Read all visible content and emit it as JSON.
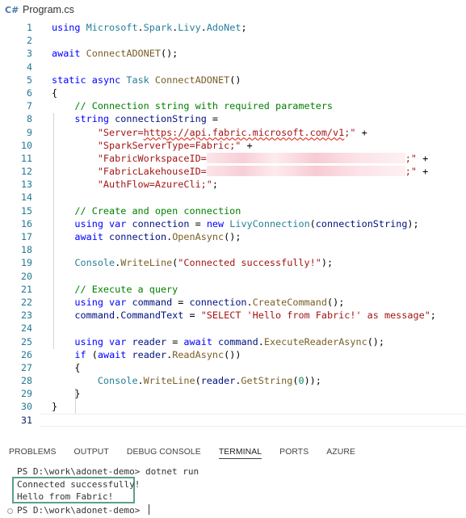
{
  "tab": {
    "icon": "csharp-file-icon",
    "label": "Program.cs"
  },
  "lines": [
    {
      "n": "1",
      "tokens": [
        [
          "kw",
          "using"
        ],
        [
          "pn",
          " "
        ],
        [
          "ty",
          "Microsoft"
        ],
        [
          "pn",
          "."
        ],
        [
          "ty",
          "Spark"
        ],
        [
          "pn",
          "."
        ],
        [
          "ty",
          "Livy"
        ],
        [
          "pn",
          "."
        ],
        [
          "ty",
          "AdoNet"
        ],
        [
          "pn",
          ";"
        ]
      ]
    },
    {
      "n": "2",
      "tokens": []
    },
    {
      "n": "3",
      "tokens": [
        [
          "kw",
          "await"
        ],
        [
          "pn",
          " "
        ],
        [
          "fn",
          "ConnectADONET"
        ],
        [
          "pn",
          "();"
        ]
      ]
    },
    {
      "n": "4",
      "tokens": []
    },
    {
      "n": "5",
      "tokens": [
        [
          "kw",
          "static"
        ],
        [
          "pn",
          " "
        ],
        [
          "kw",
          "async"
        ],
        [
          "pn",
          " "
        ],
        [
          "ty",
          "Task"
        ],
        [
          "pn",
          " "
        ],
        [
          "fn",
          "ConnectADONET"
        ],
        [
          "pn",
          "()"
        ]
      ]
    },
    {
      "n": "6",
      "tokens": [
        [
          "pn",
          "{"
        ]
      ]
    },
    {
      "n": "7",
      "tokens": [
        [
          "pn",
          "    "
        ],
        [
          "cm",
          "// Connection string with required parameters"
        ]
      ]
    },
    {
      "n": "8",
      "tokens": [
        [
          "pn",
          "    "
        ],
        [
          "kw",
          "string"
        ],
        [
          "pn",
          " "
        ],
        [
          "var",
          "connectionString"
        ],
        [
          "pn",
          " ="
        ]
      ]
    },
    {
      "n": "9",
      "tokens": [
        [
          "pn",
          "        "
        ],
        [
          "str",
          "\"Server="
        ],
        [
          "str squig",
          "https://api.fabric.microsoft.com/v1"
        ],
        [
          "str",
          ";\""
        ],
        [
          "pn",
          " +"
        ]
      ]
    },
    {
      "n": "10",
      "tokens": [
        [
          "pn",
          "        "
        ],
        [
          "str",
          "\"SparkServerType=Fabric;\""
        ],
        [
          "pn",
          " +"
        ]
      ]
    },
    {
      "n": "11",
      "tokens": [
        [
          "pn",
          "        "
        ],
        [
          "str",
          "\"FabricWorkspaceID="
        ],
        [
          "redact",
          ""
        ],
        [
          "str",
          ";\""
        ],
        [
          "pn",
          " +"
        ]
      ]
    },
    {
      "n": "12",
      "tokens": [
        [
          "pn",
          "        "
        ],
        [
          "str",
          "\"FabricLakehouseID="
        ],
        [
          "redact",
          ""
        ],
        [
          "str",
          ";\""
        ],
        [
          "pn",
          " +"
        ]
      ]
    },
    {
      "n": "13",
      "tokens": [
        [
          "pn",
          "        "
        ],
        [
          "str",
          "\"AuthFlow=AzureCli;\""
        ],
        [
          "pn",
          ";"
        ]
      ]
    },
    {
      "n": "14",
      "tokens": []
    },
    {
      "n": "15",
      "tokens": [
        [
          "pn",
          "    "
        ],
        [
          "cm",
          "// Create and open connection"
        ]
      ]
    },
    {
      "n": "16",
      "tokens": [
        [
          "pn",
          "    "
        ],
        [
          "kw",
          "using"
        ],
        [
          "pn",
          " "
        ],
        [
          "kw",
          "var"
        ],
        [
          "pn",
          " "
        ],
        [
          "var",
          "connection"
        ],
        [
          "pn",
          " = "
        ],
        [
          "kw",
          "new"
        ],
        [
          "pn",
          " "
        ],
        [
          "ty",
          "LivyConnection"
        ],
        [
          "pn",
          "("
        ],
        [
          "var",
          "connectionString"
        ],
        [
          "pn",
          ");"
        ]
      ]
    },
    {
      "n": "17",
      "tokens": [
        [
          "pn",
          "    "
        ],
        [
          "kw",
          "await"
        ],
        [
          "pn",
          " "
        ],
        [
          "var",
          "connection"
        ],
        [
          "pn",
          "."
        ],
        [
          "fn",
          "OpenAsync"
        ],
        [
          "pn",
          "();"
        ]
      ]
    },
    {
      "n": "18",
      "tokens": []
    },
    {
      "n": "19",
      "tokens": [
        [
          "pn",
          "    "
        ],
        [
          "ty",
          "Console"
        ],
        [
          "pn",
          "."
        ],
        [
          "fn",
          "WriteLine"
        ],
        [
          "pn",
          "("
        ],
        [
          "str",
          "\"Connected successfully!\""
        ],
        [
          "pn",
          ");"
        ]
      ]
    },
    {
      "n": "20",
      "tokens": []
    },
    {
      "n": "21",
      "tokens": [
        [
          "pn",
          "    "
        ],
        [
          "cm",
          "// Execute a query"
        ]
      ]
    },
    {
      "n": "22",
      "tokens": [
        [
          "pn",
          "    "
        ],
        [
          "kw",
          "using"
        ],
        [
          "pn",
          " "
        ],
        [
          "kw",
          "var"
        ],
        [
          "pn",
          " "
        ],
        [
          "var",
          "command"
        ],
        [
          "pn",
          " = "
        ],
        [
          "var",
          "connection"
        ],
        [
          "pn",
          "."
        ],
        [
          "fn",
          "CreateCommand"
        ],
        [
          "pn",
          "();"
        ]
      ]
    },
    {
      "n": "23",
      "tokens": [
        [
          "pn",
          "    "
        ],
        [
          "var",
          "command"
        ],
        [
          "pn",
          "."
        ],
        [
          "var",
          "CommandText"
        ],
        [
          "pn",
          " = "
        ],
        [
          "str",
          "\"SELECT 'Hello from Fabric!' as message\""
        ],
        [
          "pn",
          ";"
        ]
      ]
    },
    {
      "n": "24",
      "tokens": []
    },
    {
      "n": "25",
      "tokens": [
        [
          "pn",
          "    "
        ],
        [
          "kw",
          "using"
        ],
        [
          "pn",
          " "
        ],
        [
          "kw",
          "var"
        ],
        [
          "pn",
          " "
        ],
        [
          "var",
          "reader"
        ],
        [
          "pn",
          " = "
        ],
        [
          "kw",
          "await"
        ],
        [
          "pn",
          " "
        ],
        [
          "var",
          "command"
        ],
        [
          "pn",
          "."
        ],
        [
          "fn",
          "ExecuteReaderAsync"
        ],
        [
          "pn",
          "();"
        ]
      ]
    },
    {
      "n": "26",
      "tokens": [
        [
          "pn",
          "    "
        ],
        [
          "kw",
          "if"
        ],
        [
          "pn",
          " ("
        ],
        [
          "kw",
          "await"
        ],
        [
          "pn",
          " "
        ],
        [
          "var",
          "reader"
        ],
        [
          "pn",
          "."
        ],
        [
          "fn",
          "ReadAsync"
        ],
        [
          "pn",
          "())"
        ]
      ]
    },
    {
      "n": "27",
      "tokens": [
        [
          "pn",
          "    {"
        ]
      ]
    },
    {
      "n": "28",
      "tokens": [
        [
          "pn",
          "        "
        ],
        [
          "ty",
          "Console"
        ],
        [
          "pn",
          "."
        ],
        [
          "fn",
          "WriteLine"
        ],
        [
          "pn",
          "("
        ],
        [
          "var",
          "reader"
        ],
        [
          "pn",
          "."
        ],
        [
          "fn",
          "GetString"
        ],
        [
          "pn",
          "("
        ],
        [
          "num",
          "0"
        ],
        [
          "pn",
          "));"
        ]
      ]
    },
    {
      "n": "29",
      "tokens": [
        [
          "pn",
          "    }"
        ]
      ]
    },
    {
      "n": "30",
      "tokens": [
        [
          "pn",
          "}"
        ]
      ]
    },
    {
      "n": "31",
      "tokens": []
    }
  ],
  "current_line": "31",
  "panel": {
    "tabs": [
      "PROBLEMS",
      "OUTPUT",
      "DEBUG CONSOLE",
      "TERMINAL",
      "PORTS",
      "AZURE"
    ],
    "active_tab": "TERMINAL"
  },
  "terminal": {
    "prompt1": "PS D:\\work\\adonet-demo> dotnet run",
    "out1": "Connected successfully!",
    "out2": "Hello from Fabric!",
    "prompt2": "PS D:\\work\\adonet-demo> "
  },
  "colors": {
    "keyword": "#0000ff",
    "type": "#267f99",
    "function": "#795e26",
    "variable": "#001080",
    "string": "#a31515",
    "comment": "#008000",
    "line_number": "#237893",
    "highlight_box": "#5ba08f"
  }
}
